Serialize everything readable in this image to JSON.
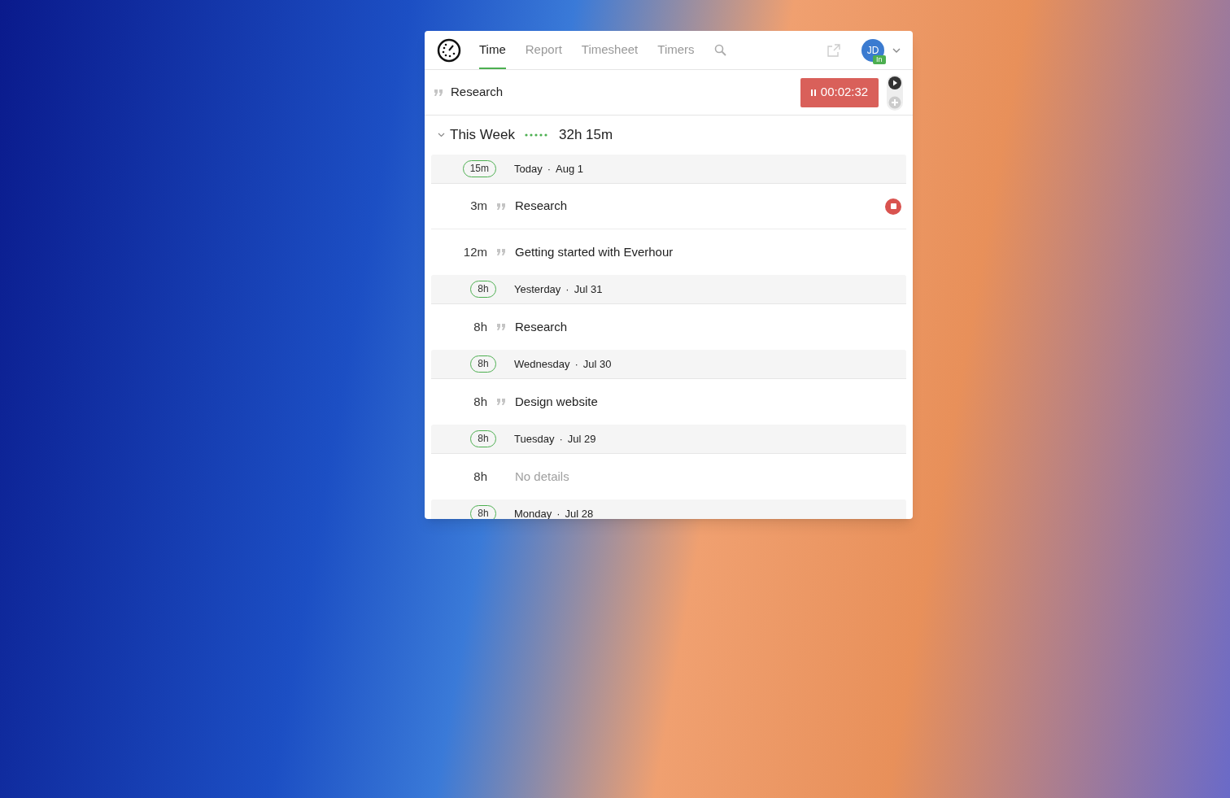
{
  "tabs": [
    {
      "label": "Time",
      "selected": true
    },
    {
      "label": "Report",
      "selected": false
    },
    {
      "label": "Timesheet",
      "selected": false
    },
    {
      "label": "Timers",
      "selected": false
    }
  ],
  "user": {
    "initials": "JD",
    "status": "In"
  },
  "timer": {
    "task": "Research",
    "elapsed": "00:02:32",
    "running": true
  },
  "week": {
    "title": "This Week",
    "expanded": true,
    "total": "32h 15m"
  },
  "days": [
    {
      "total": "15m",
      "label": "Today",
      "separator": "·",
      "date": "Aug 1",
      "entries": [
        {
          "kind": "task",
          "duration": "3m",
          "text": "Research",
          "running": true
        },
        {
          "kind": "task",
          "duration": "12m",
          "text": "Getting started with Everhour",
          "running": false
        }
      ]
    },
    {
      "total": "8h",
      "label": "Yesterday",
      "separator": "·",
      "date": "Jul 31",
      "entries": [
        {
          "kind": "task",
          "duration": "8h",
          "text": "Research",
          "running": false
        }
      ]
    },
    {
      "total": "8h",
      "label": "Wednesday",
      "separator": "·",
      "date": "Jul 30",
      "entries": [
        {
          "kind": "task",
          "duration": "8h",
          "text": "Design website",
          "running": false
        }
      ]
    },
    {
      "total": "8h",
      "label": "Tuesday",
      "separator": "·",
      "date": "Jul 29",
      "entries": [
        {
          "kind": "empty",
          "duration": "8h",
          "text": "No details",
          "running": false
        }
      ]
    },
    {
      "total": "8h",
      "label": "Monday",
      "separator": "·",
      "date": "Jul 28"
    }
  ]
}
